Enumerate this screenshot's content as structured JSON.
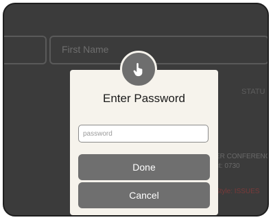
{
  "background": {
    "first_name_label": "First Name",
    "status_label": "STATU",
    "conference_text": "ER CONFERENC",
    "acct_text": "ct: 0730",
    "style_text": "Style: ISSUES"
  },
  "modal": {
    "title": "Enter Password",
    "password_placeholder": "password",
    "password_value": "",
    "done_label": "Done",
    "cancel_label": "Cancel",
    "badge_icon": "pointing-hand-icon"
  },
  "colors": {
    "overlay": "#3b3b3b",
    "modal_bg": "#f6f3ec",
    "button_bg": "#6f6f6f",
    "badge_bg": "#6e6e6e"
  }
}
